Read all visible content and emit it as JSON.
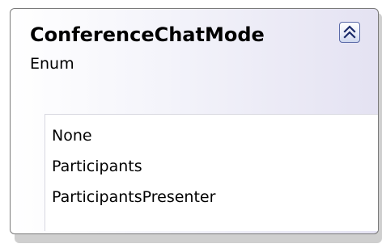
{
  "enum": {
    "name": "ConferenceChatMode",
    "kind": "Enum",
    "collapse_icon": "double-chevron-up-icon",
    "members": [
      "None",
      "Participants",
      "ParticipantsPresenter"
    ]
  }
}
